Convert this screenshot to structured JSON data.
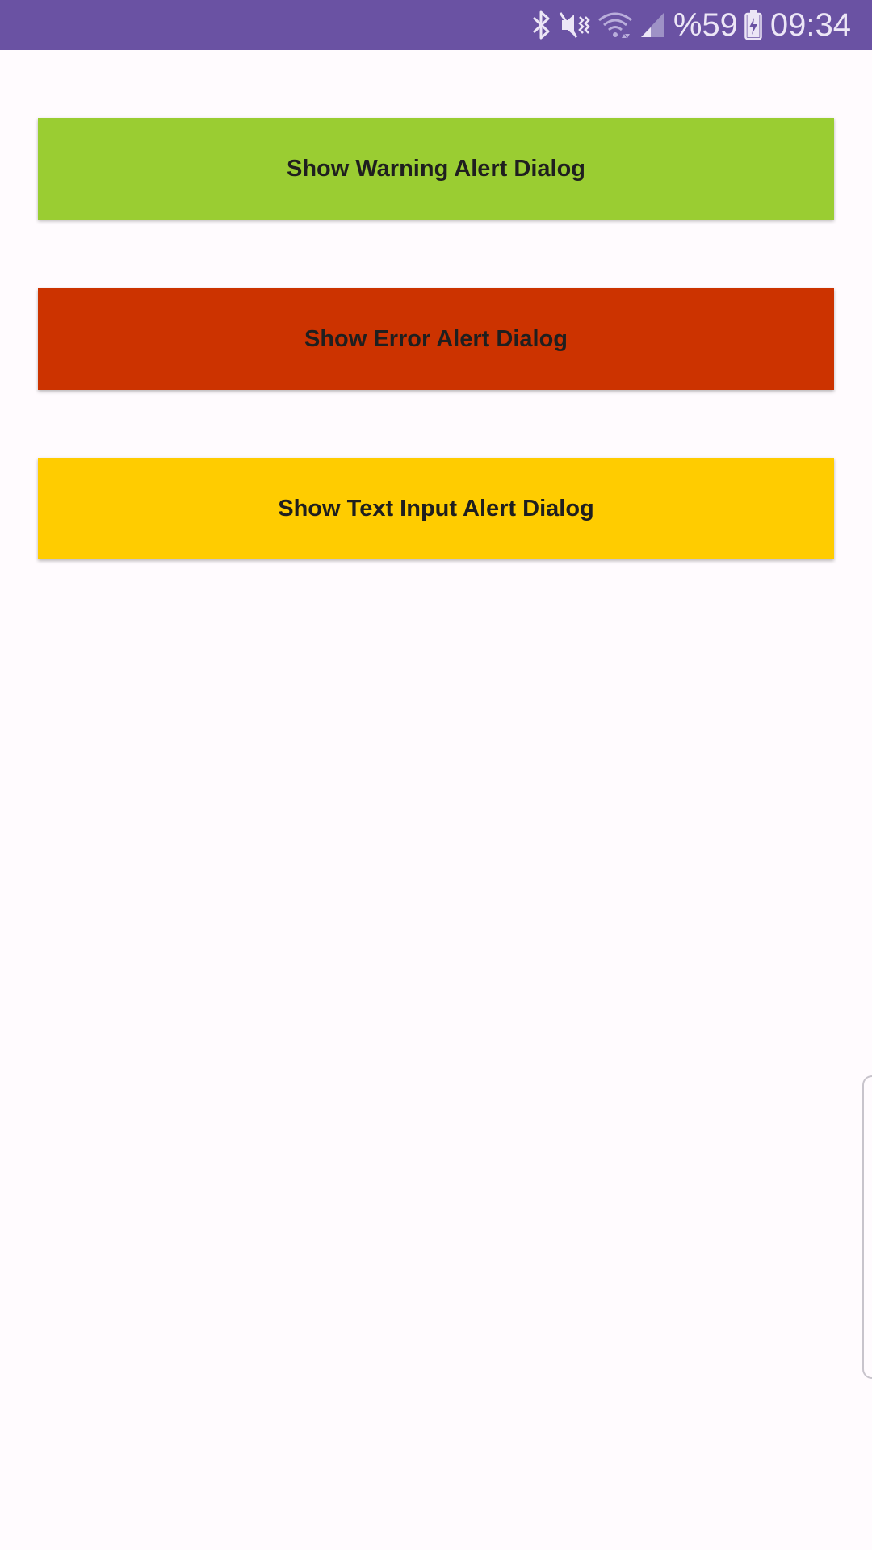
{
  "status_bar": {
    "icons": [
      "bluetooth-icon",
      "mute-vibrate-icon",
      "wifi-icon",
      "signal-icon",
      "battery-charging-icon"
    ],
    "battery_text": "%59",
    "time": "09:34",
    "background": "#6a52a3"
  },
  "buttons": {
    "warning": {
      "label": "Show Warning Alert Dialog",
      "color": "#9acd32"
    },
    "error": {
      "label": "Show Error Alert Dialog",
      "color": "#cc3300"
    },
    "text_input": {
      "label": "Show Text Input Alert Dialog",
      "color": "#ffcc00"
    }
  },
  "colors": {
    "page_background": "#fffbfe",
    "button_text": "#1f1f1f"
  }
}
